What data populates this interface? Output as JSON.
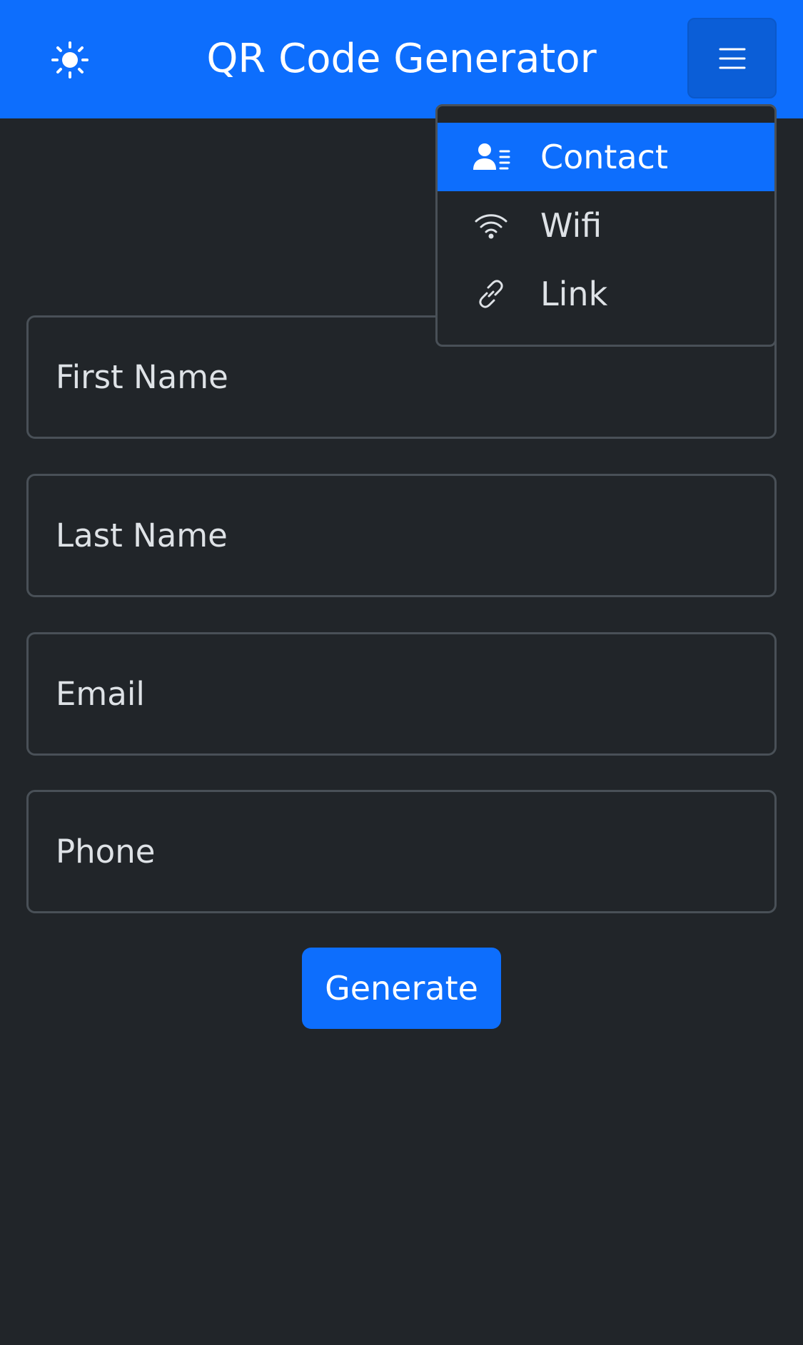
{
  "header": {
    "title": "QR Code Generator",
    "theme_icon": "sun-icon",
    "menu_icon": "hamburger-menu-icon",
    "bg_color": "#0d6efd"
  },
  "menu": {
    "items": [
      {
        "label": "Contact",
        "icon": "contact-card-icon",
        "active": true
      },
      {
        "label": "Wifi",
        "icon": "wifi-icon",
        "active": false
      },
      {
        "label": "Link",
        "icon": "link-icon",
        "active": false
      }
    ]
  },
  "form": {
    "first_name": {
      "placeholder": "First Name",
      "value": ""
    },
    "last_name": {
      "placeholder": "Last Name",
      "value": ""
    },
    "email": {
      "placeholder": "Email",
      "value": ""
    },
    "phone": {
      "placeholder": "Phone",
      "value": ""
    },
    "submit_label": "Generate"
  },
  "colors": {
    "background": "#212529",
    "accent": "#0d6efd",
    "border": "#495057",
    "text": "#dee2e6"
  }
}
